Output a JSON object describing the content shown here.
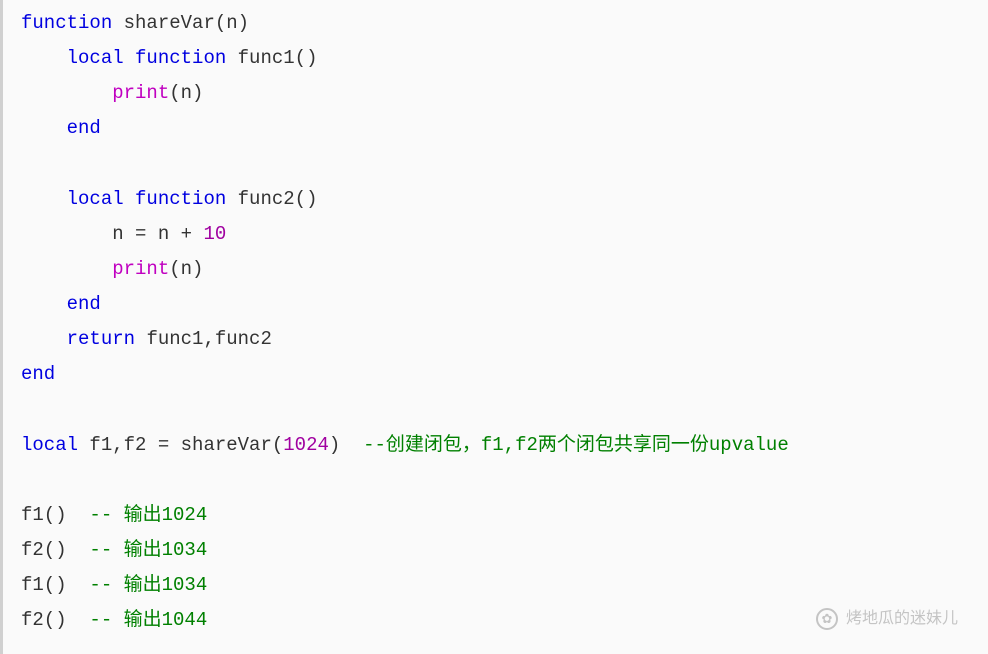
{
  "code": {
    "line1": {
      "kw1": "function",
      "sp1": " ",
      "id1": "shareVar(n)"
    },
    "line2": {
      "indent": "    ",
      "kw1": "local",
      "sp1": " ",
      "kw2": "function",
      "sp2": " ",
      "id1": "func1()"
    },
    "line3": {
      "indent": "        ",
      "fn1": "print",
      "id1": "(n)"
    },
    "line4": {
      "indent": "    ",
      "kw1": "end"
    },
    "line5": {
      "blank": ""
    },
    "line6": {
      "indent": "    ",
      "kw1": "local",
      "sp1": " ",
      "kw2": "function",
      "sp2": " ",
      "id1": "func2()"
    },
    "line7": {
      "indent": "        ",
      "id1": "n = n + ",
      "num1": "10"
    },
    "line8": {
      "indent": "        ",
      "fn1": "print",
      "id1": "(n)"
    },
    "line9": {
      "indent": "    ",
      "kw1": "end"
    },
    "line10": {
      "indent": "    ",
      "kw1": "return",
      "sp1": " ",
      "id1": "func1,func2"
    },
    "line11": {
      "kw1": "end"
    },
    "line12": {
      "blank": ""
    },
    "line13": {
      "kw1": "local",
      "sp1": " ",
      "id1": "f1,f2 = shareVar(",
      "num1": "1024",
      "id2": ")  ",
      "cmt1": "--创建闭包，f1,f2两个闭包共享同一份upvalue"
    },
    "line14": {
      "blank": ""
    },
    "line15": {
      "id1": "f1()  ",
      "cmt1": "-- 输出1024"
    },
    "line16": {
      "id1": "f2()  ",
      "cmt1": "-- 输出1034"
    },
    "line17": {
      "id1": "f1()  ",
      "cmt1": "-- 输出1034"
    },
    "line18": {
      "id1": "f2()  ",
      "cmt1": "-- 输出1044"
    }
  },
  "watermark": {
    "text": "烤地瓜的迷妹儿",
    "icon": "✿"
  }
}
